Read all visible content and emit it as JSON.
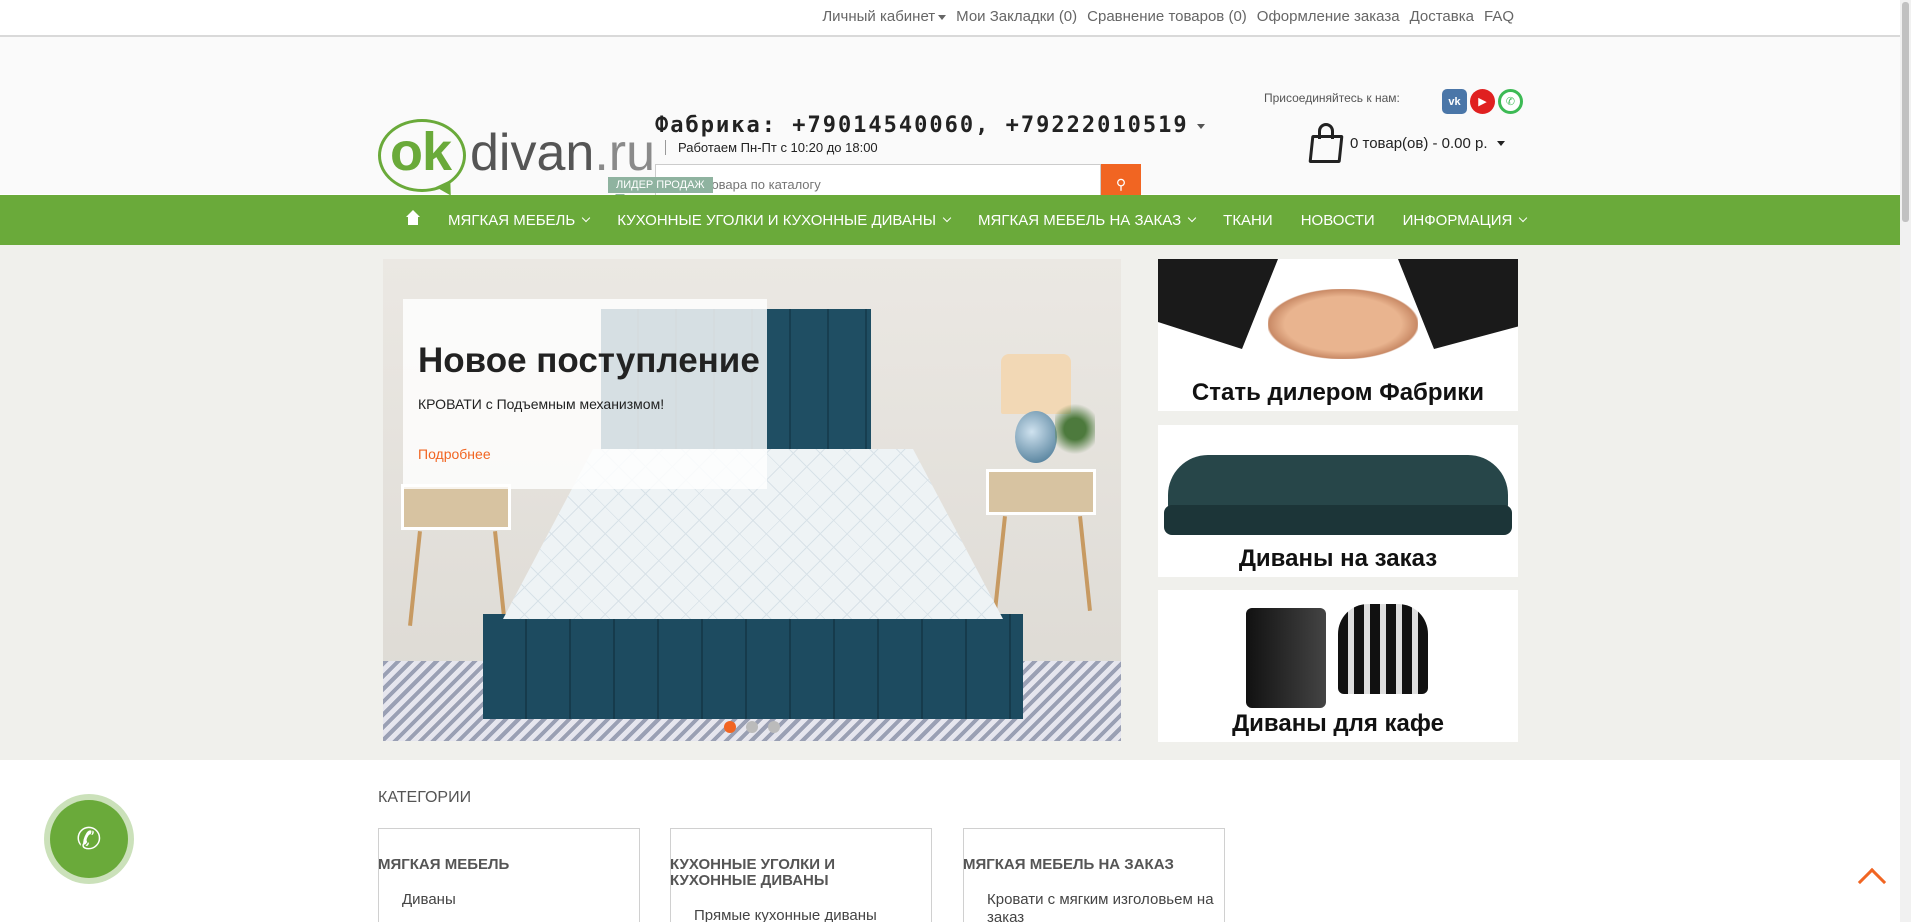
{
  "topbar": {
    "account": "Личный кабинет",
    "bookmarks": "Мои Закладки (0)",
    "compare": "Сравнение товаров (0)",
    "checkout": "Оформление заказа",
    "delivery": "Доставка",
    "faq": "FAQ"
  },
  "header": {
    "logo_ok": "ok",
    "logo_divan": "divan",
    "logo_ru": ".ru",
    "phone": "Фабрика: +79014540060, +79222010519",
    "hours": "Работаем Пн-Пт с 10:20 до 18:00",
    "search_placeholder": "Поиск товара по каталогу",
    "join_label": "Присоединяйтесь к нам:",
    "socials": [
      "vk-icon",
      "youtube-icon",
      "whatsapp-icon"
    ],
    "cart_label": "0 товар(ов) - 0.00 р."
  },
  "nav": {
    "badge": "ЛИДЕР ПРОДАЖ",
    "items": [
      {
        "label": "МЯГКАЯ МЕБЕЛЬ",
        "dropdown": true
      },
      {
        "label": "КУХОННЫЕ УГОЛКИ И КУХОННЫЕ ДИВАНЫ",
        "dropdown": true
      },
      {
        "label": "МЯГКАЯ МЕБЕЛЬ НА ЗАКАЗ",
        "dropdown": true
      },
      {
        "label": "ТКАНИ",
        "dropdown": false
      },
      {
        "label": "НОВОСТИ",
        "dropdown": false
      },
      {
        "label": "ИНФОРМАЦИЯ",
        "dropdown": true
      }
    ]
  },
  "slider": {
    "title": "Новое поступление",
    "subtitle": "КРОВАТИ с Подъемным механизмом!",
    "more": "Подробнее",
    "slides_count": 3,
    "active_slide": 1
  },
  "promos": [
    {
      "label": "Стать дилером Фабрики"
    },
    {
      "label": "Диваны на заказ"
    },
    {
      "label": "Диваны для кафе"
    }
  ],
  "categories": {
    "title": "КАТЕГОРИИ",
    "columns": [
      {
        "heading": "МЯГКАЯ МЕБЕЛЬ",
        "items": [
          "Диваны"
        ]
      },
      {
        "heading": "КУХОННЫЕ УГОЛКИ И КУХОННЫЕ ДИВАНЫ",
        "items": [
          "Прямые кухонные диваны"
        ]
      },
      {
        "heading": "МЯГКАЯ МЕБЕЛЬ НА ЗАКАЗ",
        "items": [
          "Кровати с мягким изголовьем на заказ"
        ]
      }
    ]
  },
  "colors": {
    "brand_green": "#6aaa3a",
    "accent_orange": "#f16522"
  }
}
